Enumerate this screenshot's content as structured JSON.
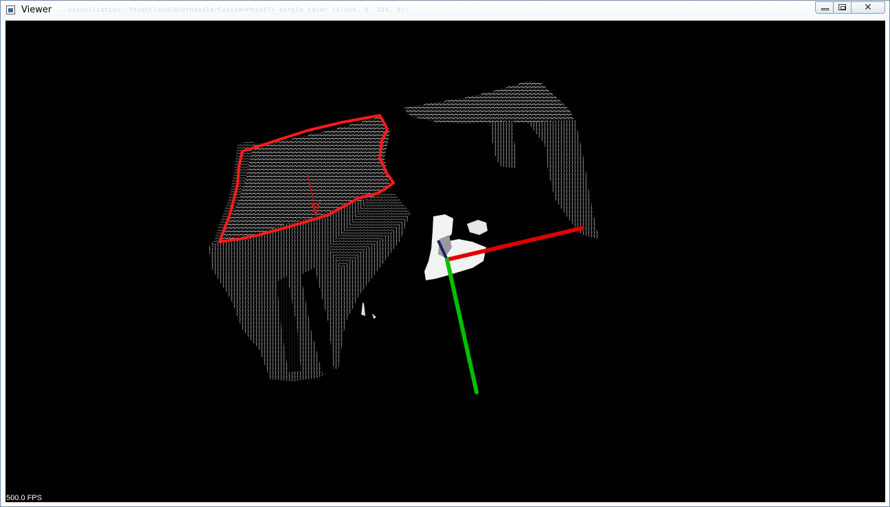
{
  "window": {
    "title": "Viewer",
    "background_text": "...visualization::PointCloudColorHandlerCustom<PointT> single_color (cloud, 0, 255, 0);",
    "controls": {
      "minimize": "minimize-icon",
      "maximize": "restore-icon",
      "close": "close-icon"
    }
  },
  "viewer": {
    "background_color": "#000000",
    "point_color": "#ffffff",
    "plane_outline_color": "#ff1a1a",
    "normal_arrow_color": "#d01010",
    "axes": {
      "x_color": "#e00000",
      "y_color": "#00c000",
      "z_color": "#1a1a6e"
    },
    "fps_label": "500.0 FPS"
  }
}
